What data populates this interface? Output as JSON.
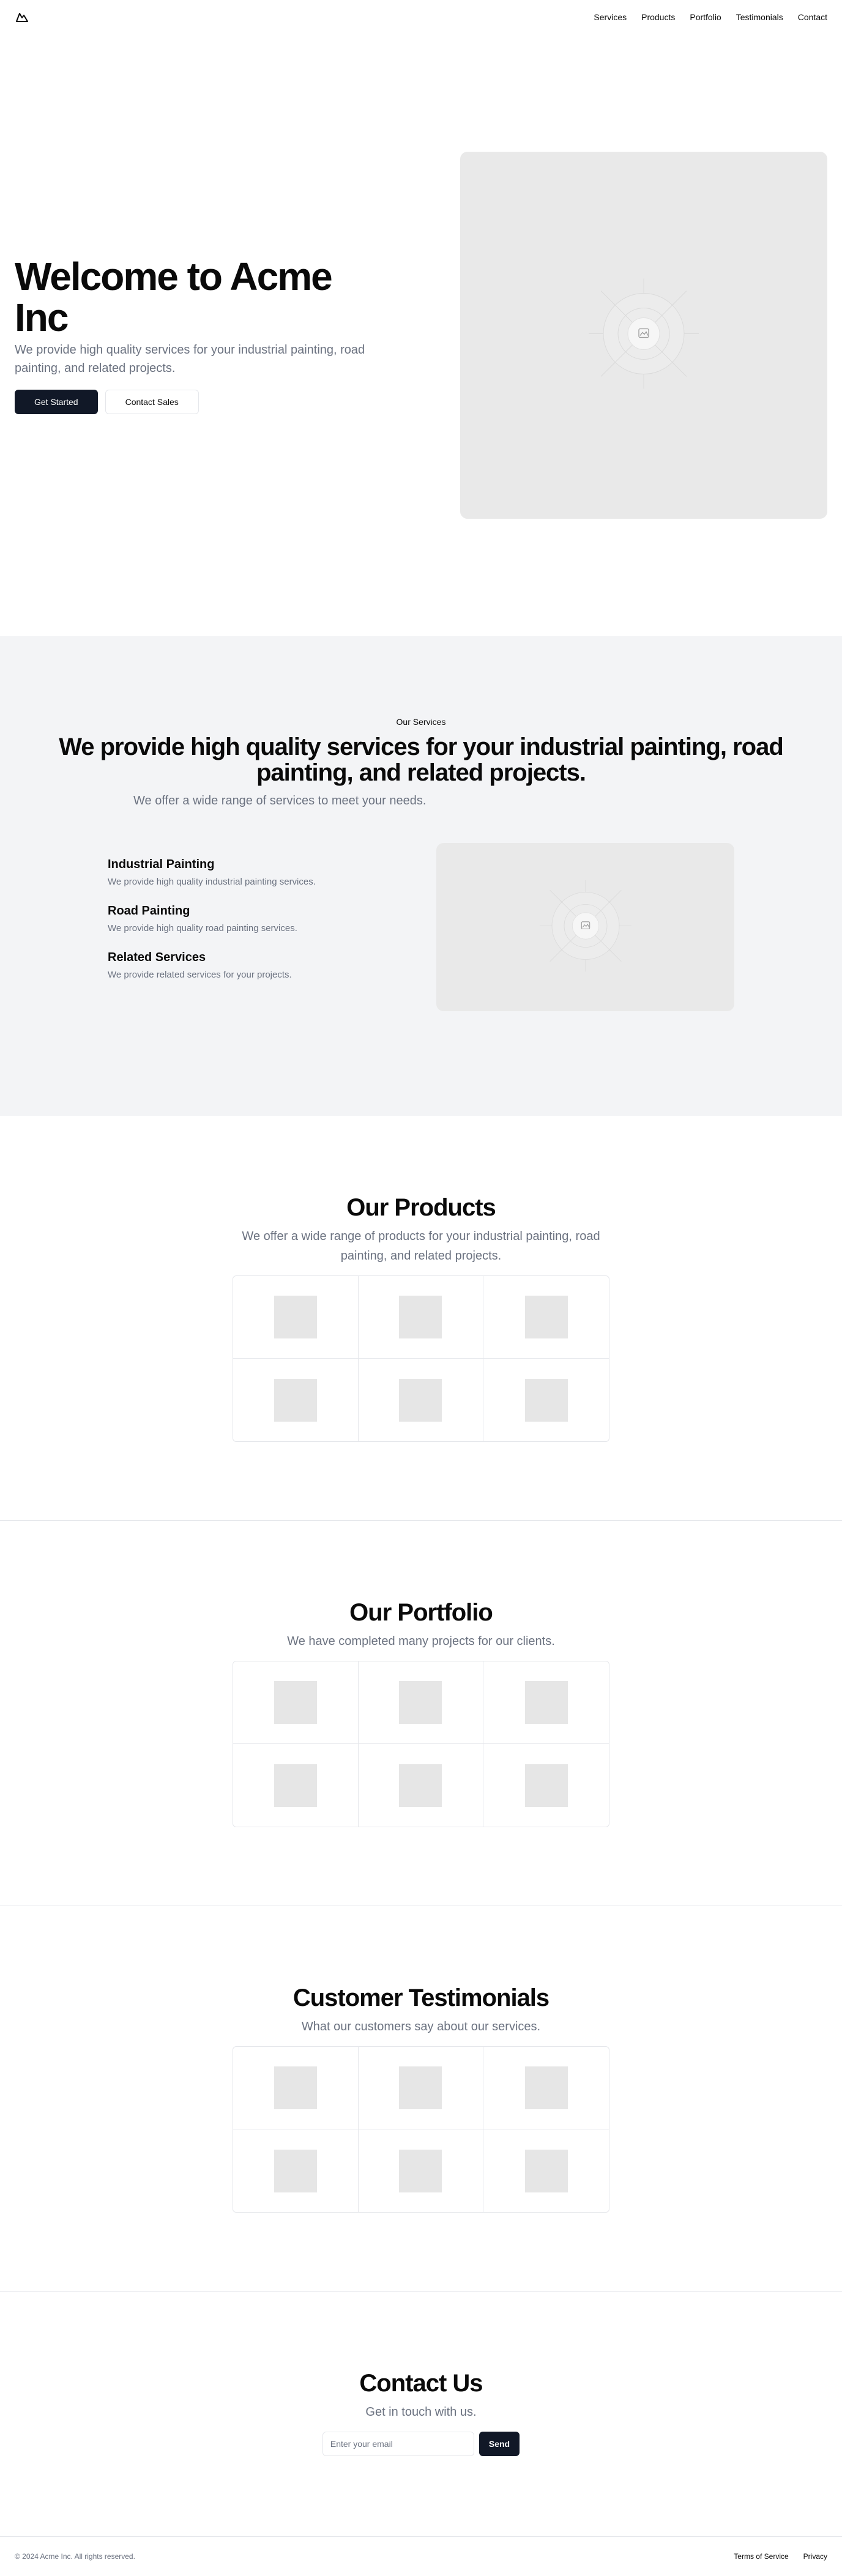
{
  "header": {
    "logo_icon": "mountain-icon",
    "nav": [
      "Services",
      "Products",
      "Portfolio",
      "Testimonials",
      "Contact"
    ]
  },
  "hero": {
    "title": "Welcome to Acme Inc",
    "subtitle": "We provide high quality services for your industrial painting, road painting, and related projects.",
    "primary_button": "Get Started",
    "secondary_button": "Contact Sales",
    "image_icon": "image-placeholder-icon"
  },
  "services": {
    "eyebrow": "Our Services",
    "title": "We provide high quality services for your industrial painting, road painting, and related projects.",
    "subtitle": "We offer a wide range of services to meet your needs.",
    "items": [
      {
        "title": "Industrial Painting",
        "description": "We provide high quality industrial painting services."
      },
      {
        "title": "Road Painting",
        "description": "We provide high quality road painting services."
      },
      {
        "title": "Related Services",
        "description": "We provide related services for your projects."
      }
    ]
  },
  "products": {
    "title": "Our Products",
    "subtitle": "We offer a wide range of products for your industrial painting, road painting, and related projects."
  },
  "portfolio": {
    "title": "Our Portfolio",
    "subtitle": "We have completed many projects for our clients."
  },
  "testimonials": {
    "title": "Customer Testimonials",
    "subtitle": "What our customers say about our services."
  },
  "contact": {
    "title": "Contact Us",
    "subtitle": "Get in touch with us.",
    "email_placeholder": "Enter your email",
    "send_button": "Send"
  },
  "footer": {
    "copyright": "© 2024 Acme Inc. All rights reserved.",
    "links": [
      "Terms of Service",
      "Privacy"
    ]
  },
  "colors": {
    "primary_button": "#111827",
    "muted_text": "#6b7280",
    "section_bg": "#f3f4f6",
    "placeholder_bg": "#e9e9e9"
  }
}
